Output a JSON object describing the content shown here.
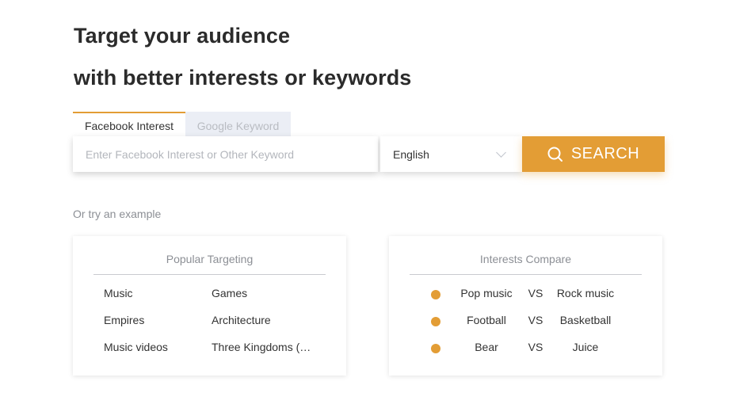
{
  "heading": {
    "line1": "Target your audience",
    "line2": "with better interests or keywords"
  },
  "tabs": [
    {
      "label": "Facebook Interest",
      "active": true
    },
    {
      "label": "Google Keyword",
      "active": false
    }
  ],
  "search": {
    "placeholder": "Enter Facebook Interest or Other Keyword",
    "value": ""
  },
  "language": {
    "selected": "English"
  },
  "search_button": {
    "label": "SEARCH",
    "icon": "search-icon"
  },
  "example_label": "Or try an example",
  "popular": {
    "title": "Popular Targeting",
    "items": [
      "Music",
      "Games",
      "Empires",
      "Architecture",
      "Music videos",
      "Three Kingdoms (…"
    ]
  },
  "compare": {
    "title": "Interests Compare",
    "vs_label": "VS",
    "rows": [
      {
        "a": "Pop music",
        "b": "Rock music"
      },
      {
        "a": "Football",
        "b": "Basketball"
      },
      {
        "a": "Bear",
        "b": "Juice"
      }
    ]
  },
  "colors": {
    "accent": "#e39d35",
    "inactive_tab_bg": "#ebeef5",
    "heading_text": "#2b2b2b",
    "muted_text": "#8c8f95"
  }
}
